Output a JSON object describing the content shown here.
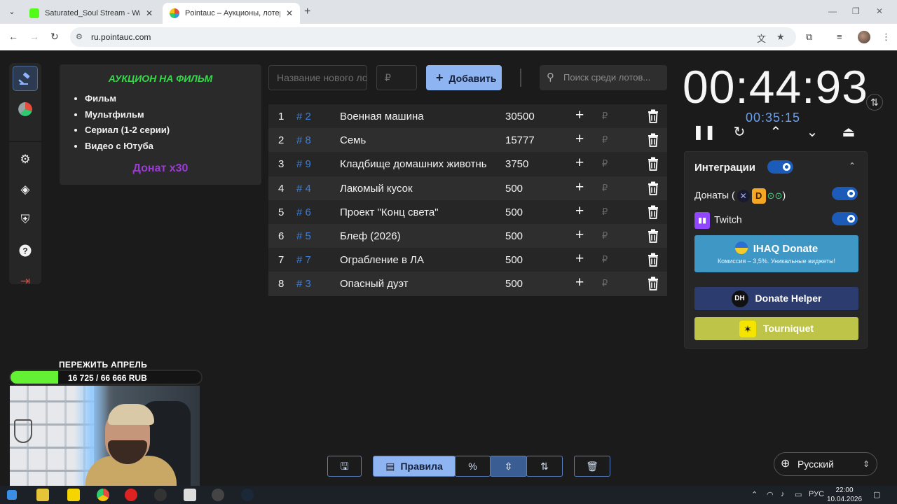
{
  "browser": {
    "tabs": [
      {
        "title": "Saturated_Soul Stream - Watch",
        "favicon_color": "#53fc18"
      },
      {
        "title": "Pointauc – Аукционы, лотереи",
        "favicon_color": "#9b59b6"
      }
    ],
    "url": "ru.pointauc.com"
  },
  "rules": {
    "title": "АУКЦИОН НА ФИЛЬМ",
    "items": [
      "Фильм",
      "Мультфильм",
      "Сериал (1-2 серии)",
      "Видео с Ютуба"
    ],
    "donat": "Донат x30"
  },
  "controls": {
    "name_placeholder": "Название нового лота",
    "amount_placeholder": "₽",
    "add_label": "Добавить",
    "search_placeholder": "Поиск среди лотов..."
  },
  "lots": [
    {
      "num": "1",
      "id": "# 2",
      "name": "Военная машина",
      "amount": "30500"
    },
    {
      "num": "2",
      "id": "# 8",
      "name": "Семь",
      "amount": "15777"
    },
    {
      "num": "3",
      "id": "# 9",
      "name": "Кладбище домашних животных",
      "amount": "3750"
    },
    {
      "num": "4",
      "id": "# 4",
      "name": "Лакомый кусок",
      "amount": "500"
    },
    {
      "num": "5",
      "id": "# 6",
      "name": "Проект \"Конц света\"",
      "amount": "500"
    },
    {
      "num": "6",
      "id": "# 5",
      "name": "Блеф (2026)",
      "amount": "500"
    },
    {
      "num": "7",
      "id": "# 7",
      "name": "Ограбление в ЛА",
      "amount": "500"
    },
    {
      "num": "8",
      "id": "# 3",
      "name": "Опасный дуэт",
      "amount": "500"
    }
  ],
  "currency": "₽",
  "timer": {
    "main": "00:44:93",
    "sub": "00:35:15"
  },
  "integrations": {
    "title": "Интеграции",
    "donations_label_start": "Донаты (",
    "donations_label_end": ")",
    "twitch_label": "Twitch",
    "ihaq_title": "IHAQ Donate",
    "ihaq_subtitle": "Комиссия – 3,5%. Уникальные виджеты!",
    "dh_badge": "DH",
    "donate_helper": "Donate Helper",
    "tourniquet": "Tourniquet"
  },
  "bottom": {
    "rules_label": "Правила",
    "percent_label": "%"
  },
  "language": "Русский",
  "overlay": {
    "goal_title": "ПЕРЕЖИТЬ АПРЕЛЬ",
    "goal_text": "16 725 / 66 666 RUB",
    "goal_progress": 0.2509
  },
  "system": {
    "lang": "РУС",
    "time": "22:00",
    "date": "10.04.2026"
  }
}
